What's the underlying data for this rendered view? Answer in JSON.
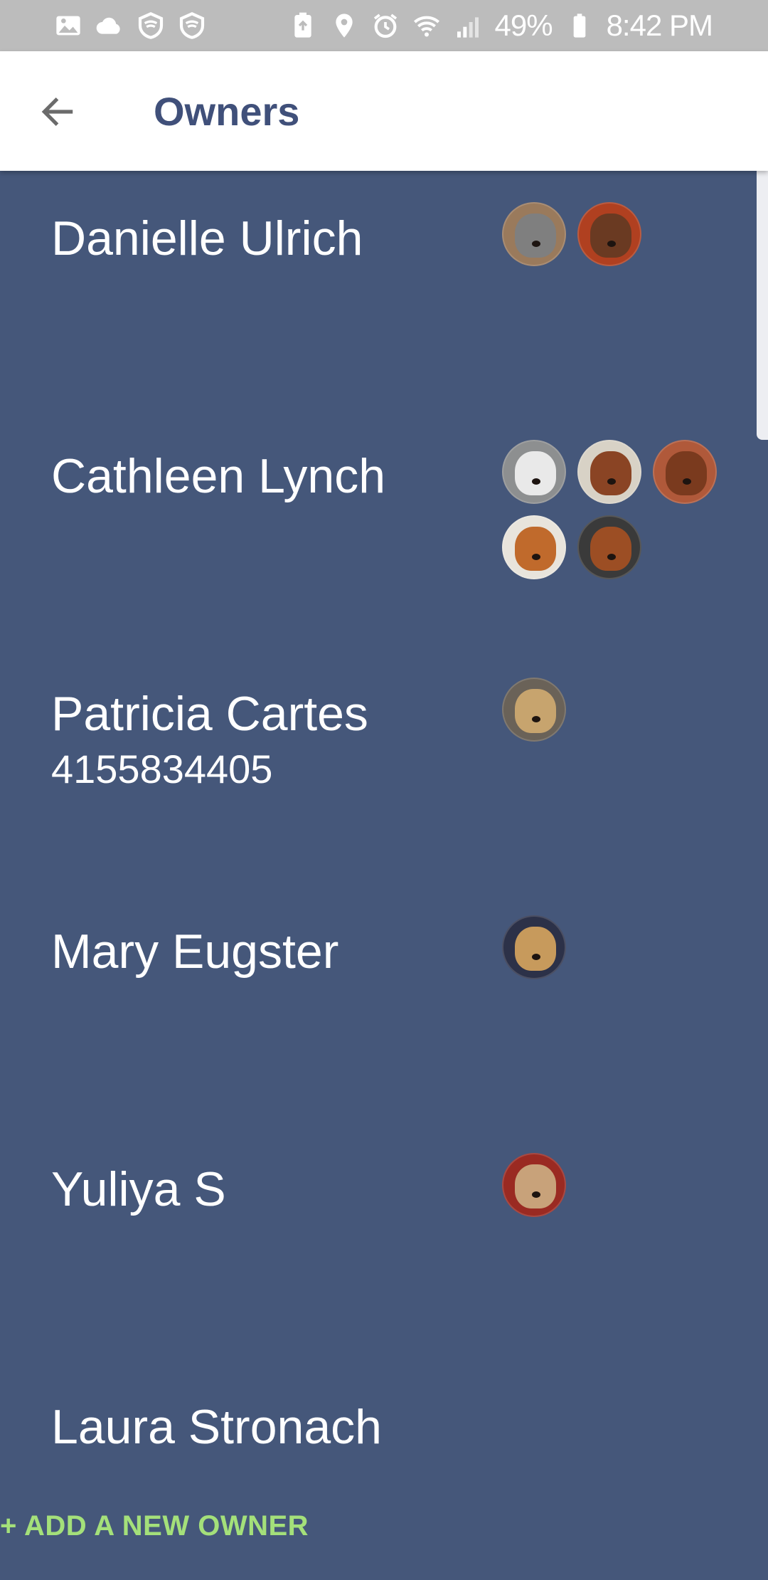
{
  "status_bar": {
    "battery_percent": "49%",
    "time": "8:42 PM",
    "icons_left": [
      "image-icon",
      "cloud-icon",
      "shield-icon",
      "shield-icon"
    ],
    "icons_right": [
      "battery-saver-icon",
      "location-icon",
      "alarm-icon",
      "wifi-icon",
      "signal-icon"
    ]
  },
  "app_bar": {
    "title": "Owners",
    "back_icon": "arrow-left-icon"
  },
  "owners": [
    {
      "name": "Danielle Ulrich",
      "phone": "",
      "pets": [
        {
          "bg": "#9a7a5c",
          "fur": "#7f7f7f"
        },
        {
          "bg": "#b04020",
          "fur": "#6a3a22"
        }
      ]
    },
    {
      "name": "Cathleen Lynch",
      "phone": "",
      "pets": [
        {
          "bg": "#8d8f90",
          "fur": "#e9e9e9"
        },
        {
          "bg": "#d8d2c6",
          "fur": "#8a4424"
        },
        {
          "bg": "#b0593a",
          "fur": "#7a3a1e"
        },
        {
          "bg": "#e8e4dc",
          "fur": "#c06a2c"
        },
        {
          "bg": "#3a3a3a",
          "fur": "#9c4e24"
        }
      ]
    },
    {
      "name": "Patricia Cartes",
      "phone": "4155834405",
      "pets": [
        {
          "bg": "#6a6258",
          "fur": "#c7a46e"
        }
      ]
    },
    {
      "name": "Mary Eugster",
      "phone": "",
      "pets": [
        {
          "bg": "#2c3148",
          "fur": "#c79a5c"
        }
      ]
    },
    {
      "name": "Yuliya S",
      "phone": "",
      "pets": [
        {
          "bg": "#9a2a22",
          "fur": "#c8a27a"
        }
      ]
    },
    {
      "name": "Laura Stronach",
      "phone": "",
      "pets": []
    }
  ],
  "footer": {
    "add_owner_label": "+ ADD A NEW OWNER"
  },
  "colors": {
    "list_bg": "#45577a",
    "title": "#40507a",
    "accent_green": "#a4e07a",
    "status_bar": "#bcbcbc"
  }
}
